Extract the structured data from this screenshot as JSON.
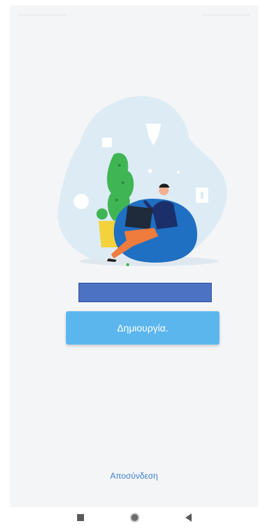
{
  "welcome": {
    "redacted_text": "",
    "create_button_label": "Δημιουργία."
  },
  "footer": {
    "logout_label": "Αποσύνδεση"
  },
  "system_nav": {
    "recents_icon": "square-icon",
    "home_icon": "circle-icon",
    "back_icon": "triangle-left-icon"
  }
}
